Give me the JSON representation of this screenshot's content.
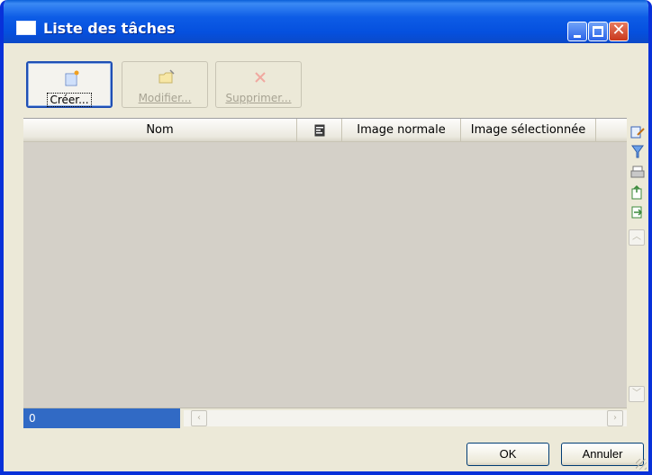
{
  "window": {
    "title": "Liste des tâches"
  },
  "toolbar": {
    "create_label": "Créer...",
    "modify_label": "Modifier...",
    "delete_label": "Supprimer..."
  },
  "table": {
    "columns": [
      "Nom",
      "",
      "Image normale",
      "Image sélectionnée"
    ]
  },
  "status": {
    "count": "0"
  },
  "buttons": {
    "ok": "OK",
    "cancel": "Annuler"
  },
  "colors": {
    "titlebar": "#0b58e0",
    "selection": "#316ac5",
    "grid_background": "#d4d0c8",
    "window_background": "#ece9d8"
  },
  "icons": {
    "create": "new-item-icon",
    "modify": "folder-edit-icon",
    "delete": "delete-x-icon",
    "column": "properties-icon",
    "side": [
      "edit-icon",
      "filter-icon",
      "print-icon",
      "export-icon",
      "transfer-icon"
    ]
  }
}
